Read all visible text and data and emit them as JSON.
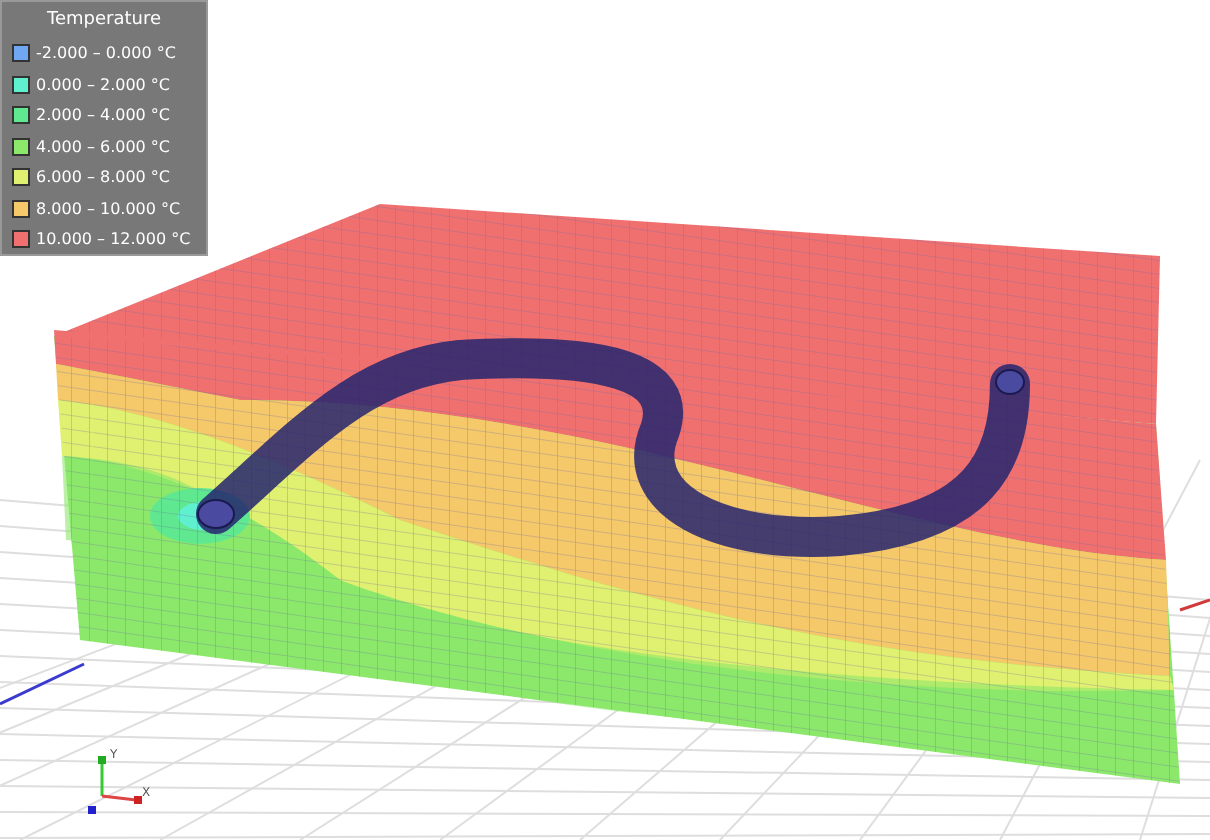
{
  "legend": {
    "title": "Temperature",
    "items": [
      {
        "label": "-2.000 – 0.000 °C",
        "color": "#6fa8f0"
      },
      {
        "label": "0.000 – 2.000 °C",
        "color": "#5ff0d0"
      },
      {
        "label": "2.000 – 4.000 °C",
        "color": "#5fe890"
      },
      {
        "label": "4.000 – 6.000 °C",
        "color": "#8ce86a"
      },
      {
        "label": "6.000 – 8.000 °C",
        "color": "#e0f070"
      },
      {
        "label": "8.000 – 10.000 °C",
        "color": "#f5c86a"
      },
      {
        "label": "10.000 – 12.000 °C",
        "color": "#f07070"
      }
    ]
  },
  "axis_triad": {
    "y_label": "Y",
    "x_label": "X"
  }
}
